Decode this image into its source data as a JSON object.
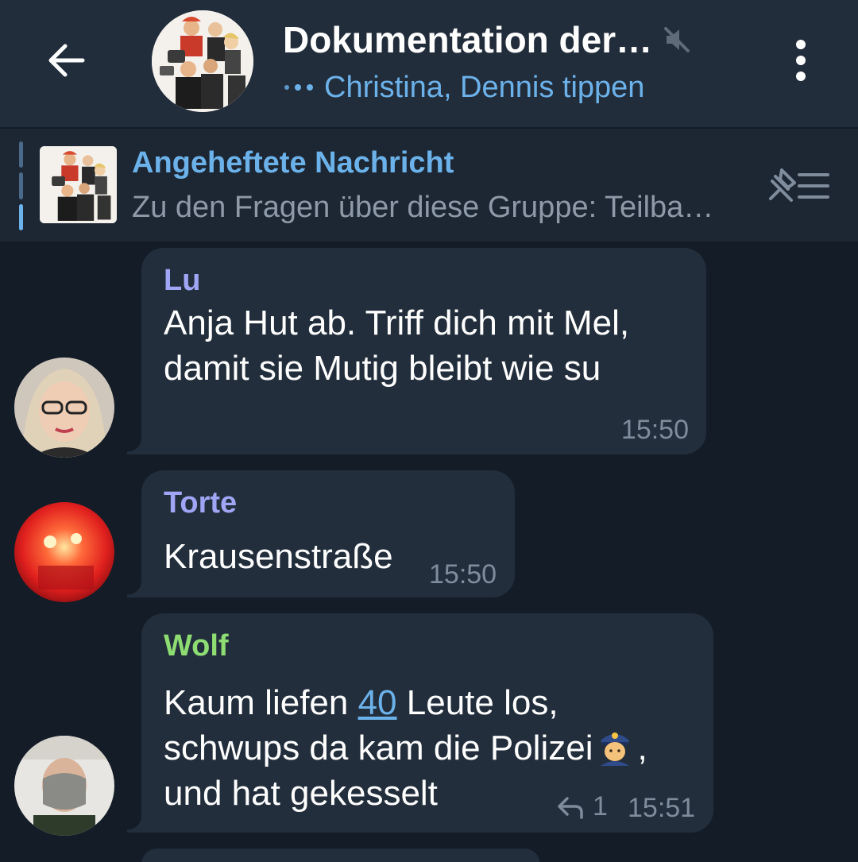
{
  "header": {
    "title": "Dokumentation der…",
    "typing": "Christina, Dennis tippen"
  },
  "pinned": {
    "title": "Angeheftete Nachricht",
    "text": "Zu den Fragen über diese Gruppe:  Teilba…"
  },
  "messages": [
    {
      "sender": "Lu",
      "sender_color": "#a0a6f5",
      "lines": [
        "Anja Hut ab. Triff dich mit Mel,",
        "damit sie Mutig bleibt wie su"
      ],
      "time": "15:50"
    },
    {
      "sender": "Torte",
      "sender_color": "#a0a6f5",
      "lines": [
        "Krausenstraße"
      ],
      "time": "15:50"
    },
    {
      "sender": "Wolf",
      "sender_color": "#8ddd72",
      "text_before_link": "Kaum liefen ",
      "link": "40",
      "text_after_link": " Leute los,",
      "line2": "schwups da kam die Polizei",
      "line2_end": ",",
      "line3": "und hat gekesselt",
      "replies": "1",
      "time": "15:51"
    }
  ],
  "icons": [
    "back-arrow-icon",
    "muted-speaker-icon",
    "more-vertical-icon",
    "pin-list-icon",
    "reply-icon",
    "police-officer-emoji"
  ]
}
